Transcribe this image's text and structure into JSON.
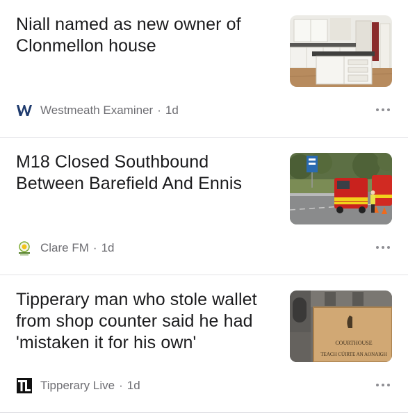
{
  "articles": [
    {
      "headline": "Niall named as new owner of Clonmellon house",
      "source": "Westmeath Examiner",
      "age": "1d",
      "thumbnail_icon": "kitchen-photo",
      "logo_icon": "westmeath-examiner-logo"
    },
    {
      "headline": "M18 Closed Southbound Between Barefield And Ennis",
      "source": "Clare FM",
      "age": "1d",
      "thumbnail_icon": "fire-engine-photo",
      "logo_icon": "clare-fm-logo"
    },
    {
      "headline": "Tipperary man who stole wallet from shop counter said he had 'mistaken it for his own'",
      "source": "Tipperary Live",
      "age": "1d",
      "thumbnail_icon": "courthouse-photo",
      "logo_icon": "tipperary-live-logo",
      "thumbnail_text": {
        "line1": "COURTHOUSE",
        "line2": "TEACH CÚIRTE AN AONAIGH"
      }
    }
  ],
  "separator": "·",
  "more_icon": "more-options-icon",
  "colors": {
    "text": "#1b1b1d",
    "meta": "#6e6e73",
    "divider": "#e2e2e6"
  }
}
